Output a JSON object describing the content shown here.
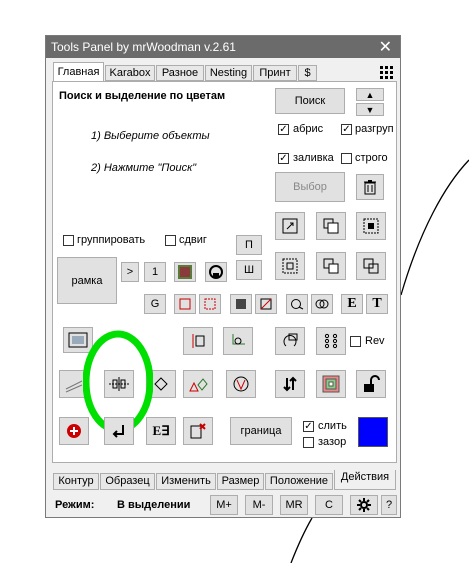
{
  "window": {
    "title": "Tools Panel by mrWoodman v.2.61",
    "close": "✕"
  },
  "tabs": [
    "Главная",
    "Karabox",
    "Разное",
    "Nesting",
    "Принт",
    "$"
  ],
  "main": {
    "heading": "Поиск и выделение по цветам",
    "step1": "1) Выберите объекты",
    "step2": "2) Нажмите \"Поиск\"",
    "search_button": "Поиск",
    "select_button": "Выбор",
    "chk_abris": "абрис",
    "chk_razgrup": "разгруп",
    "chk_zalivka": "заливка",
    "chk_strogo": "строго",
    "chk_group": "группировать",
    "chk_sdvig": "сдвиг",
    "btn_p": "П",
    "btn_sh": "Ш",
    "btn_ramka": "рамка",
    "btn_gt": ">",
    "btn_1": "1",
    "btn_g": "G",
    "btn_e": "E",
    "btn_t": "T",
    "chk_rev": "Rev",
    "btn_granitsa": "граница",
    "chk_slit": "слить",
    "chk_zazor": "зазор",
    "color_swatch": "#0000ff"
  },
  "bottom_tabs": [
    "Контур",
    "Образец",
    "Изменить",
    "Размер",
    "Положение",
    "Действия"
  ],
  "status": {
    "label": "Режим:",
    "value": "В выделении",
    "buttons": [
      "M+",
      "M-",
      "MR",
      "C",
      "?"
    ]
  }
}
